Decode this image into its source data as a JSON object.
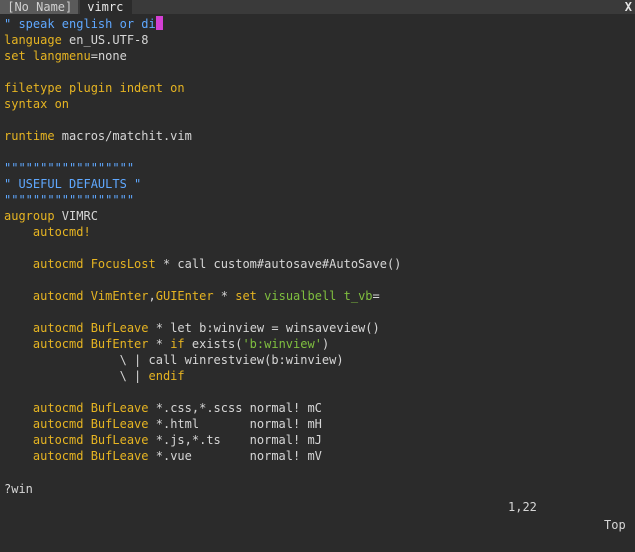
{
  "tabs": [
    {
      "label": " [No Name] ",
      "active": false
    },
    {
      "label": " vimrc ",
      "active": true
    }
  ],
  "tab_close": "X",
  "lines": [
    [
      {
        "t": "\" speak english or di",
        "c": "c-comment"
      },
      {
        "cursor": true
      }
    ],
    [
      {
        "t": "language",
        "c": "c-kw"
      },
      {
        "t": " en_US.UTF-8",
        "c": "c-text"
      }
    ],
    [
      {
        "t": "set",
        "c": "c-kw"
      },
      {
        "t": " langmenu",
        "c": "c-kw"
      },
      {
        "t": "=none",
        "c": "c-text"
      }
    ],
    [],
    [
      {
        "t": "filetype plugin indent on",
        "c": "c-kw"
      }
    ],
    [
      {
        "t": "syntax",
        "c": "c-kw"
      },
      {
        "t": " on",
        "c": "c-kw"
      }
    ],
    [],
    [
      {
        "t": "runtime",
        "c": "c-kw"
      },
      {
        "t": " macros/matchit.vim",
        "c": "c-text"
      }
    ],
    [],
    [
      {
        "t": "\"\"\"\"\"\"\"\"\"\"\"\"\"\"\"\"\"\"",
        "c": "c-comment"
      }
    ],
    [
      {
        "t": "\" USEFUL DEFAULTS \"",
        "c": "c-comment"
      }
    ],
    [
      {
        "t": "\"\"\"\"\"\"\"\"\"\"\"\"\"\"\"\"\"\"",
        "c": "c-comment"
      }
    ],
    [
      {
        "t": "augroup",
        "c": "c-kw"
      },
      {
        "t": " VIMRC",
        "c": "c-text"
      }
    ],
    [
      {
        "t": "    autocmd!",
        "c": "c-kw"
      }
    ],
    [],
    [
      {
        "t": "    autocmd",
        "c": "c-kw"
      },
      {
        "t": " FocusLost",
        "c": "c-event"
      },
      {
        "t": " * ",
        "c": "c-text"
      },
      {
        "t": "call",
        "c": "c-text"
      },
      {
        "t": " custom#autosave#AutoSave()",
        "c": "c-text"
      }
    ],
    [],
    [
      {
        "t": "    autocmd",
        "c": "c-kw"
      },
      {
        "t": " VimEnter",
        "c": "c-event"
      },
      {
        "t": ",",
        "c": "c-text"
      },
      {
        "t": "GUIEnter",
        "c": "c-event"
      },
      {
        "t": " * ",
        "c": "c-text"
      },
      {
        "t": "set",
        "c": "c-kw"
      },
      {
        "t": " visualbell",
        "c": "c-green"
      },
      {
        "t": " t_vb",
        "c": "c-green"
      },
      {
        "t": "=",
        "c": "c-text"
      }
    ],
    [],
    [
      {
        "t": "    autocmd",
        "c": "c-kw"
      },
      {
        "t": " BufLeave",
        "c": "c-event"
      },
      {
        "t": " * ",
        "c": "c-text"
      },
      {
        "t": "let",
        "c": "c-text"
      },
      {
        "t": " b:winview = ",
        "c": "c-text"
      },
      {
        "t": "winsaveview",
        "c": "c-text"
      },
      {
        "t": "()",
        "c": "c-text"
      }
    ],
    [
      {
        "t": "    autocmd",
        "c": "c-kw"
      },
      {
        "t": " BufEnter",
        "c": "c-event"
      },
      {
        "t": " * ",
        "c": "c-text"
      },
      {
        "t": "if",
        "c": "c-kw"
      },
      {
        "t": " exists(",
        "c": "c-text"
      },
      {
        "t": "'b:winview'",
        "c": "c-green"
      },
      {
        "t": ")",
        "c": "c-text"
      }
    ],
    [
      {
        "t": "                \\ | ",
        "c": "c-text"
      },
      {
        "t": "call",
        "c": "c-text"
      },
      {
        "t": " winrestview(b:winview)",
        "c": "c-text"
      }
    ],
    [
      {
        "t": "                \\ | ",
        "c": "c-text"
      },
      {
        "t": "endif",
        "c": "c-kw"
      }
    ],
    [],
    [
      {
        "t": "    autocmd",
        "c": "c-kw"
      },
      {
        "t": " BufLeave",
        "c": "c-event"
      },
      {
        "t": " *.css,*.scss normal! mC",
        "c": "c-text"
      }
    ],
    [
      {
        "t": "    autocmd",
        "c": "c-kw"
      },
      {
        "t": " BufLeave",
        "c": "c-event"
      },
      {
        "t": " *.html       normal! mH",
        "c": "c-text"
      }
    ],
    [
      {
        "t": "    autocmd",
        "c": "c-kw"
      },
      {
        "t": " BufLeave",
        "c": "c-event"
      },
      {
        "t": " *.js,*.ts    normal! mJ",
        "c": "c-text"
      }
    ],
    [
      {
        "t": "    autocmd",
        "c": "c-kw"
      },
      {
        "t": " BufLeave",
        "c": "c-event"
      },
      {
        "t": " *.vue        normal! mV",
        "c": "c-text"
      }
    ]
  ],
  "status": {
    "command": "?win",
    "position": "1,22",
    "scroll": "Top"
  }
}
